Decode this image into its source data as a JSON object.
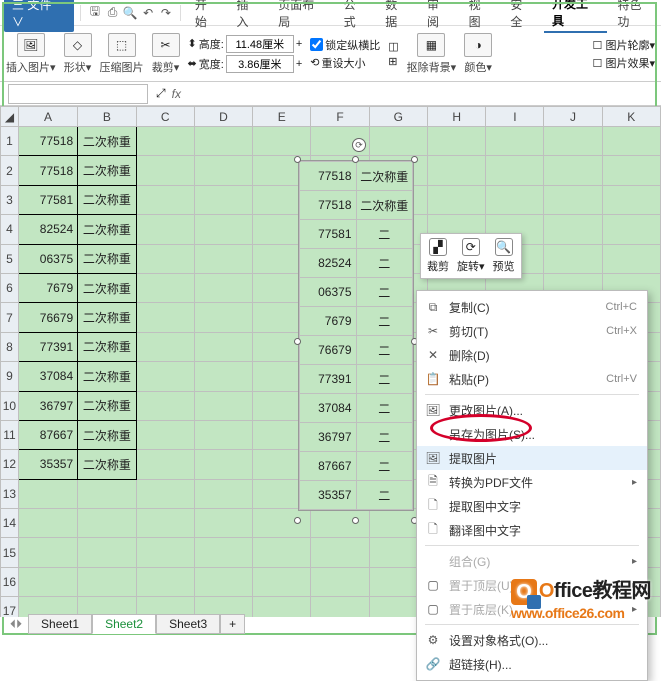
{
  "menubar": {
    "file": "三 文件 ∨",
    "tabs": [
      "开始",
      "插入",
      "页面布局",
      "公式",
      "数据",
      "审阅",
      "视图",
      "安全",
      "开发工具",
      "特色功"
    ],
    "active_tab": "开发工具"
  },
  "ribbon": {
    "insert_pic": "插入图片▾",
    "shape": "形状▾",
    "compress": "压缩图片",
    "crop": "裁剪▾",
    "height_label": "高度:",
    "height_val": "11.48厘米",
    "width_label": "宽度:",
    "width_val": "3.86厘米",
    "lock_ratio": "锁定纵横比",
    "reset_size": "重设大小",
    "remove_bg": "抠除背景▾",
    "color": "颜色▾",
    "pic_outline": "图片轮廓▾",
    "pic_effect": "图片效果▾"
  },
  "formula": {
    "name_box": "",
    "zoom_icon": "⤢"
  },
  "columns": [
    "A",
    "B",
    "C",
    "D",
    "E",
    "F",
    "G",
    "H",
    "I",
    "J",
    "K"
  ],
  "rows": [
    {
      "n": "1",
      "a": "77518",
      "b": "二次称重"
    },
    {
      "n": "2",
      "a": "77518",
      "b": "二次称重"
    },
    {
      "n": "3",
      "a": "77581",
      "b": "二次称重"
    },
    {
      "n": "4",
      "a": "82524",
      "b": "二次称重"
    },
    {
      "n": "5",
      "a": "06375",
      "b": "二次称重"
    },
    {
      "n": "6",
      "a": "7679",
      "b": "二次称重"
    },
    {
      "n": "7",
      "a": "76679",
      "b": "二次称重"
    },
    {
      "n": "8",
      "a": "77391",
      "b": "二次称重"
    },
    {
      "n": "9",
      "a": "37084",
      "b": "二次称重"
    },
    {
      "n": "10",
      "a": "36797",
      "b": "二次称重"
    },
    {
      "n": "11",
      "a": "87667",
      "b": "二次称重"
    },
    {
      "n": "12",
      "a": "35357",
      "b": "二次称重"
    }
  ],
  "empty_rows": [
    "13",
    "14",
    "15",
    "16",
    "17"
  ],
  "paste_rows": [
    {
      "a": "77518",
      "b": "二次称重"
    },
    {
      "a": "77518",
      "b": "二次称重"
    },
    {
      "a": "77581",
      "b": "二"
    },
    {
      "a": "82524",
      "b": "二"
    },
    {
      "a": "06375",
      "b": "二"
    },
    {
      "a": "7679",
      "b": "二"
    },
    {
      "a": "76679",
      "b": "二"
    },
    {
      "a": "77391",
      "b": "二"
    },
    {
      "a": "37084",
      "b": "二"
    },
    {
      "a": "36797",
      "b": "二"
    },
    {
      "a": "87667",
      "b": "二"
    },
    {
      "a": "35357",
      "b": "二"
    }
  ],
  "mini_toolbar": {
    "crop": "裁剪",
    "rotate": "旋转▾",
    "preview": "预览"
  },
  "ctx": {
    "copy": "复制(C)",
    "copy_sc": "Ctrl+C",
    "cut": "剪切(T)",
    "cut_sc": "Ctrl+X",
    "delete": "删除(D)",
    "paste": "粘贴(P)",
    "paste_sc": "Ctrl+V",
    "change_pic": "更改图片(A)...",
    "save_as_pic": "另存为图片(S)...",
    "extract_pic": "提取图片",
    "to_pdf": "转换为PDF文件",
    "extract_text": "提取图中文字",
    "translate_text": "翻译图中文字",
    "group": "组合(G)",
    "bring_front": "置于顶层(U)",
    "send_back": "置于底层(K)",
    "format_obj": "设置对象格式(O)...",
    "hyperlink": "超链接(H)..."
  },
  "sheets": {
    "s1": "Sheet1",
    "s2": "Sheet2",
    "s3": "Sheet3",
    "add": "+"
  },
  "watermark": {
    "brand": "Office教程网",
    "url": "www.office26.com"
  }
}
